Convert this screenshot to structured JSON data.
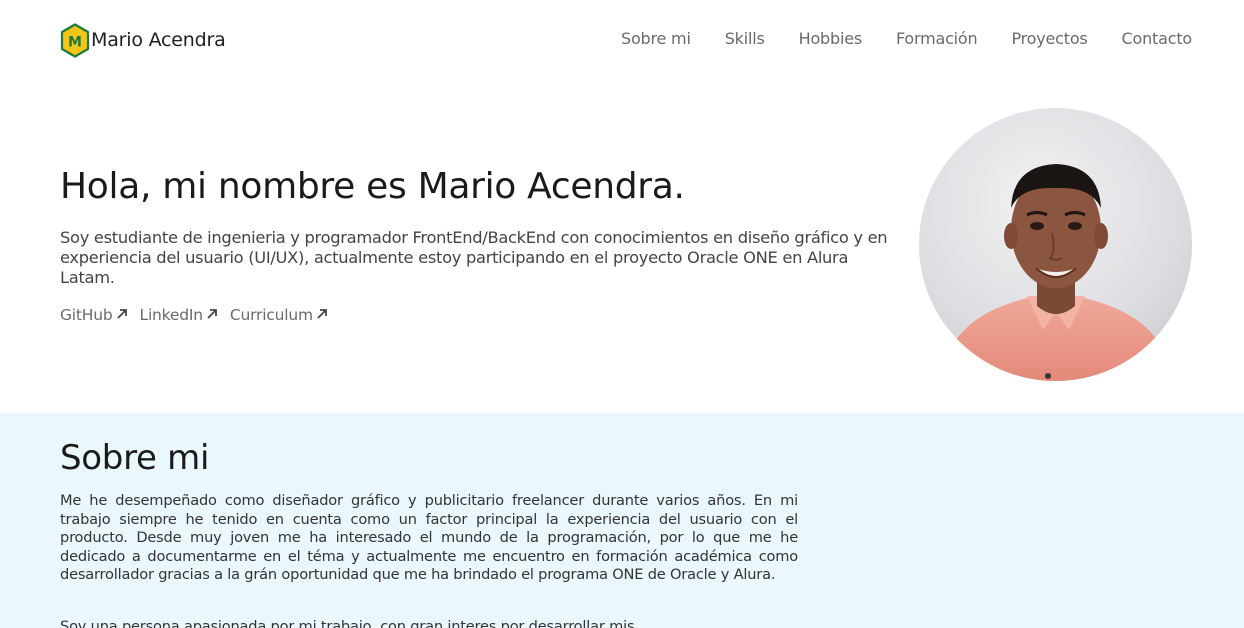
{
  "header": {
    "logo_letter": "M",
    "brand_name": "Mario Acendra",
    "nav": [
      {
        "label": "Sobre mi"
      },
      {
        "label": "Skills"
      },
      {
        "label": "Hobbies"
      },
      {
        "label": "Formación"
      },
      {
        "label": "Proyectos"
      },
      {
        "label": "Contacto"
      }
    ]
  },
  "hero": {
    "title": "Hola, mi nombre es Mario Acendra.",
    "description": "Soy estudiante de ingenieria y programador FrontEnd/BackEnd con conocimientos en diseño gráfico y en experiencia del usuario (UI/UX), actualmente estoy participando en el proyecto Oracle ONE en Alura Latam.",
    "links": [
      {
        "label": "GitHub",
        "icon": "arrow-up-right-icon"
      },
      {
        "label": "LinkedIn",
        "icon": "arrow-up-right-icon"
      },
      {
        "label": "Curriculum",
        "icon": "arrow-up-right-icon"
      }
    ]
  },
  "about": {
    "title": "Sobre mi",
    "paragraphs": [
      "Me he desempeñado como diseñador gráfico y publicitario freelancer durante varios años. En mi trabajo siempre he tenido en cuenta como un factor principal la experiencia del usuario con el producto. Desde muy joven me ha interesado el mundo de la programación, por lo que me he dedicado a documentarme en el téma y actualmente me encuentro en formación académica como desarrollador gracias a la grán oportunidad que me ha brindado el programa ONE de Oracle y Alura.",
      "Soy una persona apasionada por mi trabajo, con gran interes por desarrollar mis"
    ]
  },
  "colors": {
    "logo_fill": "#f5c518",
    "logo_outline": "#1e7b3c",
    "about_background": "#eaf7fc"
  }
}
